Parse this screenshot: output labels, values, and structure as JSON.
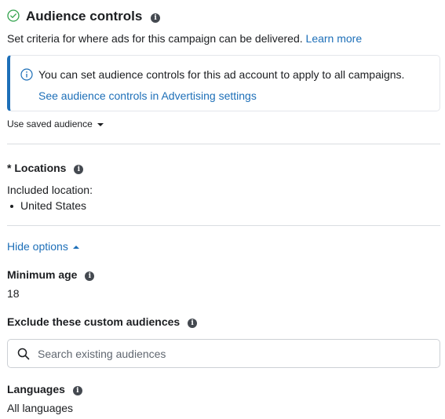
{
  "header": {
    "title": "Audience controls",
    "subtitle": "Set criteria for where ads for this campaign can be delivered.",
    "learn_more": "Learn more"
  },
  "notice": {
    "text": "You can set audience controls for this ad account to apply to all campaigns.",
    "link": "See audience controls in Advertising settings"
  },
  "saved_audience": {
    "label": "Use saved audience"
  },
  "locations": {
    "title": "* Locations",
    "included_label": "Included location:",
    "items": [
      "United States"
    ]
  },
  "options_toggle": "Hide options",
  "minimum_age": {
    "title": "Minimum age",
    "value": "18"
  },
  "custom_audiences": {
    "title": "Exclude these custom audiences",
    "search_placeholder": "Search existing audiences"
  },
  "languages": {
    "title": "Languages",
    "value": "All languages"
  },
  "colors": {
    "link": "#1d6fb8",
    "text": "#1c1e21",
    "success": "#31a24c"
  }
}
